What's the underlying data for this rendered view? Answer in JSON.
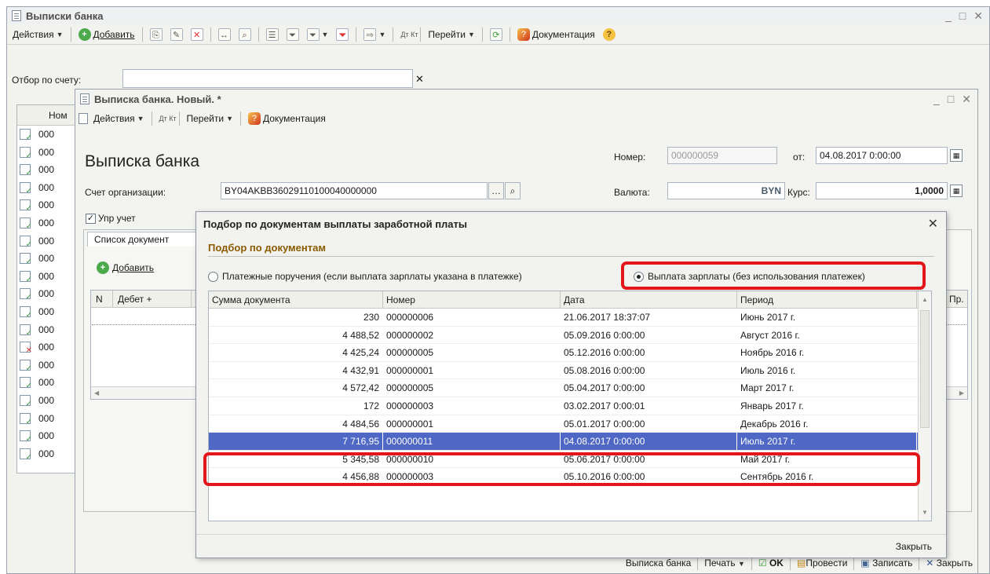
{
  "bg_window": {
    "title": "Выписки банка",
    "toolbar": {
      "actions": "Действия",
      "add": "Добавить",
      "goto": "Перейти",
      "docs": "Документация"
    },
    "filter_label": "Отбор по счету:",
    "list_header_num": "Ном",
    "row_text": "000"
  },
  "doc_window": {
    "title": "Выписка банка. Новый. *",
    "toolbar": {
      "actions": "Действия",
      "goto": "Перейти",
      "docs": "Документация"
    },
    "heading": "Выписка банка",
    "number_label": "Номер:",
    "number_value": "000000059",
    "from_label": "от:",
    "date_value": "04.08.2017 0:00:00",
    "account_label": "Счет организации:",
    "account_value": "BY04AKBB36029110100040000000",
    "currency_label": "Валюта:",
    "currency_value": "BYN",
    "rate_label": "Курс:",
    "rate_value": "1,0000",
    "mgmt_checkbox": "Упр учет",
    "tab_label": "Список документ",
    "add_button": "Добавить",
    "col_n": "N",
    "col_debit": "Дебет +",
    "col_pr": "Пр.",
    "bottom_buttons": {
      "print_form": "Выписка банка",
      "print": "Печать",
      "ok": "OK",
      "post": "Провести",
      "save": "Записать",
      "close": "Закрыть"
    }
  },
  "modal": {
    "title": "Подбор по документам выплаты заработной платы",
    "subtitle": "Подбор по документам",
    "radio1": "Платежные поручения (если выплата зарплаты указана в платежке)",
    "radio2": "Выплата зарплаты (без использования платежек)",
    "columns": [
      "Сумма документа",
      "Номер",
      "Дата",
      "Период"
    ],
    "rows": [
      {
        "sum": "230",
        "num": "000000006",
        "date": "21.06.2017 18:37:07",
        "period": "Июнь 2017 г."
      },
      {
        "sum": "4 488,52",
        "num": "000000002",
        "date": "05.09.2016 0:00:00",
        "period": "Август 2016 г."
      },
      {
        "sum": "4 425,24",
        "num": "000000005",
        "date": "05.12.2016 0:00:00",
        "period": "Ноябрь 2016 г."
      },
      {
        "sum": "4 432,91",
        "num": "000000001",
        "date": "05.08.2016 0:00:00",
        "period": "Июль 2016 г."
      },
      {
        "sum": "4 572,42",
        "num": "000000005",
        "date": "05.04.2017 0:00:00",
        "period": "Март 2017 г."
      },
      {
        "sum": "172",
        "num": "000000003",
        "date": "03.02.2017 0:00:01",
        "period": "Январь 2017 г."
      },
      {
        "sum": "4 484,56",
        "num": "000000001",
        "date": "05.01.2017 0:00:00",
        "period": "Декабрь 2016 г."
      },
      {
        "sum": "7 716,95",
        "num": "000000011",
        "date": "04.08.2017 0:00:00",
        "period": "Июль 2017 г."
      },
      {
        "sum": "5 345,58",
        "num": "000000010",
        "date": "05.06.2017 0:00:00",
        "period": "Май 2017 г."
      },
      {
        "sum": "4 456,88",
        "num": "000000003",
        "date": "05.10.2016 0:00:00",
        "period": "Сентябрь 2016 г."
      }
    ],
    "close_label": "Закрыть"
  },
  "colors": {
    "highlight": "#e3161a",
    "selected_row": "#4f68c5"
  }
}
